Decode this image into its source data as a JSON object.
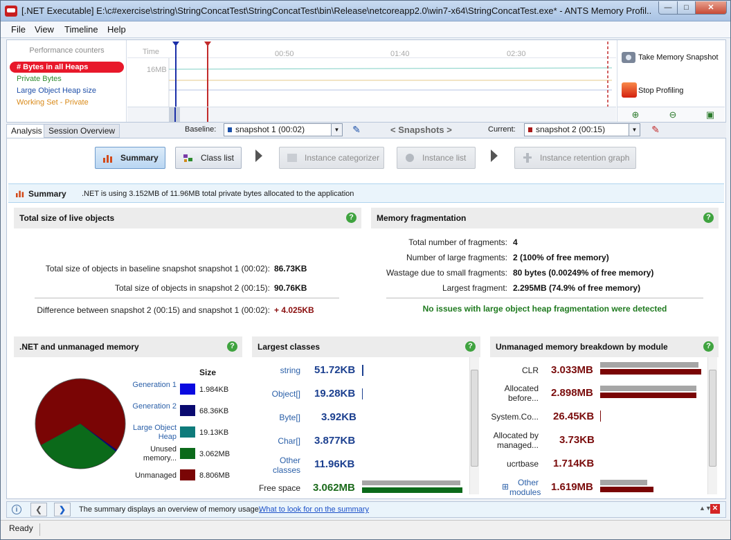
{
  "window": {
    "title": "[.NET Executable] E:\\c#exercise\\string\\StringConcatTest\\StringConcatTest\\bin\\Release\\netcoreapp2.0\\win7-x64\\StringConcatTest.exe* - ANTS Memory Profil..."
  },
  "menu": [
    "File",
    "View",
    "Timeline",
    "Help"
  ],
  "counters": {
    "title": "Performance counters",
    "items": [
      {
        "label": "# Bytes in all Heaps",
        "color": "#ffffff"
      },
      {
        "label": "Private Bytes",
        "color": "#2e8b2e"
      },
      {
        "label": "Large Object Heap size",
        "color": "#1f4fa8"
      },
      {
        "label": "Working Set - Private",
        "color": "#d98a1a"
      }
    ]
  },
  "timeline": {
    "time_label": "Time",
    "y_label": "16MB",
    "ticks": [
      "00:50",
      "01:40",
      "02:30"
    ]
  },
  "actions": {
    "snapshot": "Take Memory Snapshot",
    "stop": "Stop Profiling"
  },
  "tabs": {
    "analysis": "Analysis",
    "session": "Session Overview"
  },
  "snapshots": {
    "baseline_label": "Baseline:",
    "baseline_value": "snapshot 1 (00:02)",
    "nav": "< Snapshots >",
    "current_label": "Current:",
    "current_value": "snapshot 2 (00:15)"
  },
  "nav": {
    "summary": "Summary",
    "class_list": "Class list",
    "instance_categorizer": "Instance categorizer",
    "instance_list": "Instance list",
    "retention_graph": "Instance retention graph"
  },
  "summary": {
    "title": "Summary",
    "text": ".NET is using 3.152MB of 11.96MB total private bytes allocated to the application"
  },
  "total_size": {
    "title": "Total size of live objects",
    "baseline_label": "Total size of objects in baseline snapshot snapshot 1 (00:02):",
    "baseline_value": "86.73KB",
    "current_label": "Total size of objects in snapshot 2 (00:15):",
    "current_value": "90.76KB",
    "diff_label": "Difference between snapshot 2 (00:15) and snapshot 1 (00:02):",
    "diff_value": "+ 4.025KB"
  },
  "fragmentation": {
    "title": "Memory fragmentation",
    "rows": [
      {
        "label": "Total number of fragments:",
        "value": "4"
      },
      {
        "label": "Number of large fragments:",
        "value": "2 (100% of free memory)"
      },
      {
        "label": "Wastage due to small fragments:",
        "value": "80 bytes (0.00249% of free memory)"
      },
      {
        "label": "Largest fragment:",
        "value": "2.295MB (74.9% of free memory)"
      }
    ],
    "message": "No issues with large object heap fragmentation were detected"
  },
  "dotnet_memory": {
    "title": ".NET and unmanaged memory",
    "size_header": "Size",
    "legend": [
      {
        "label": "Generation 1",
        "value": "1.984KB",
        "color": "#0a0ae0"
      },
      {
        "label": "Generation 2",
        "value": "68.36KB",
        "color": "#0a0a70"
      },
      {
        "label": "Large Object Heap",
        "value": "19.13KB",
        "color": "#0e7b7b"
      },
      {
        "label": "Unused memory...",
        "value": "3.062MB",
        "color": "#0b6a1a"
      },
      {
        "label": "Unmanaged",
        "value": "8.806MB",
        "color": "#7a0505"
      }
    ]
  },
  "largest_classes": {
    "title": "Largest classes",
    "rows": [
      {
        "name": "string",
        "value": "51.72KB"
      },
      {
        "name": "Object[]",
        "value": "19.28KB"
      },
      {
        "name": "Byte[]",
        "value": "3.92KB"
      },
      {
        "name": "Char[]",
        "value": "3.877KB"
      },
      {
        "name": "Other classes",
        "value": "11.96KB"
      },
      {
        "name": "Free space",
        "value": "3.062MB"
      }
    ]
  },
  "unmanaged": {
    "title": "Unmanaged memory breakdown by module",
    "rows": [
      {
        "name": "CLR",
        "value": "3.033MB"
      },
      {
        "name": "Allocated before...",
        "value": "2.898MB"
      },
      {
        "name": "System.Co...",
        "value": "26.45KB"
      },
      {
        "name": "Allocated by managed...",
        "value": "3.73KB"
      },
      {
        "name": "ucrtbase",
        "value": "1.714KB"
      },
      {
        "name": "Other modules",
        "value": "1.619MB"
      }
    ]
  },
  "infobar": {
    "text": "The summary displays an overview of memory usage.",
    "link": "What to look for on the summary"
  },
  "status": {
    "text": "Ready"
  }
}
